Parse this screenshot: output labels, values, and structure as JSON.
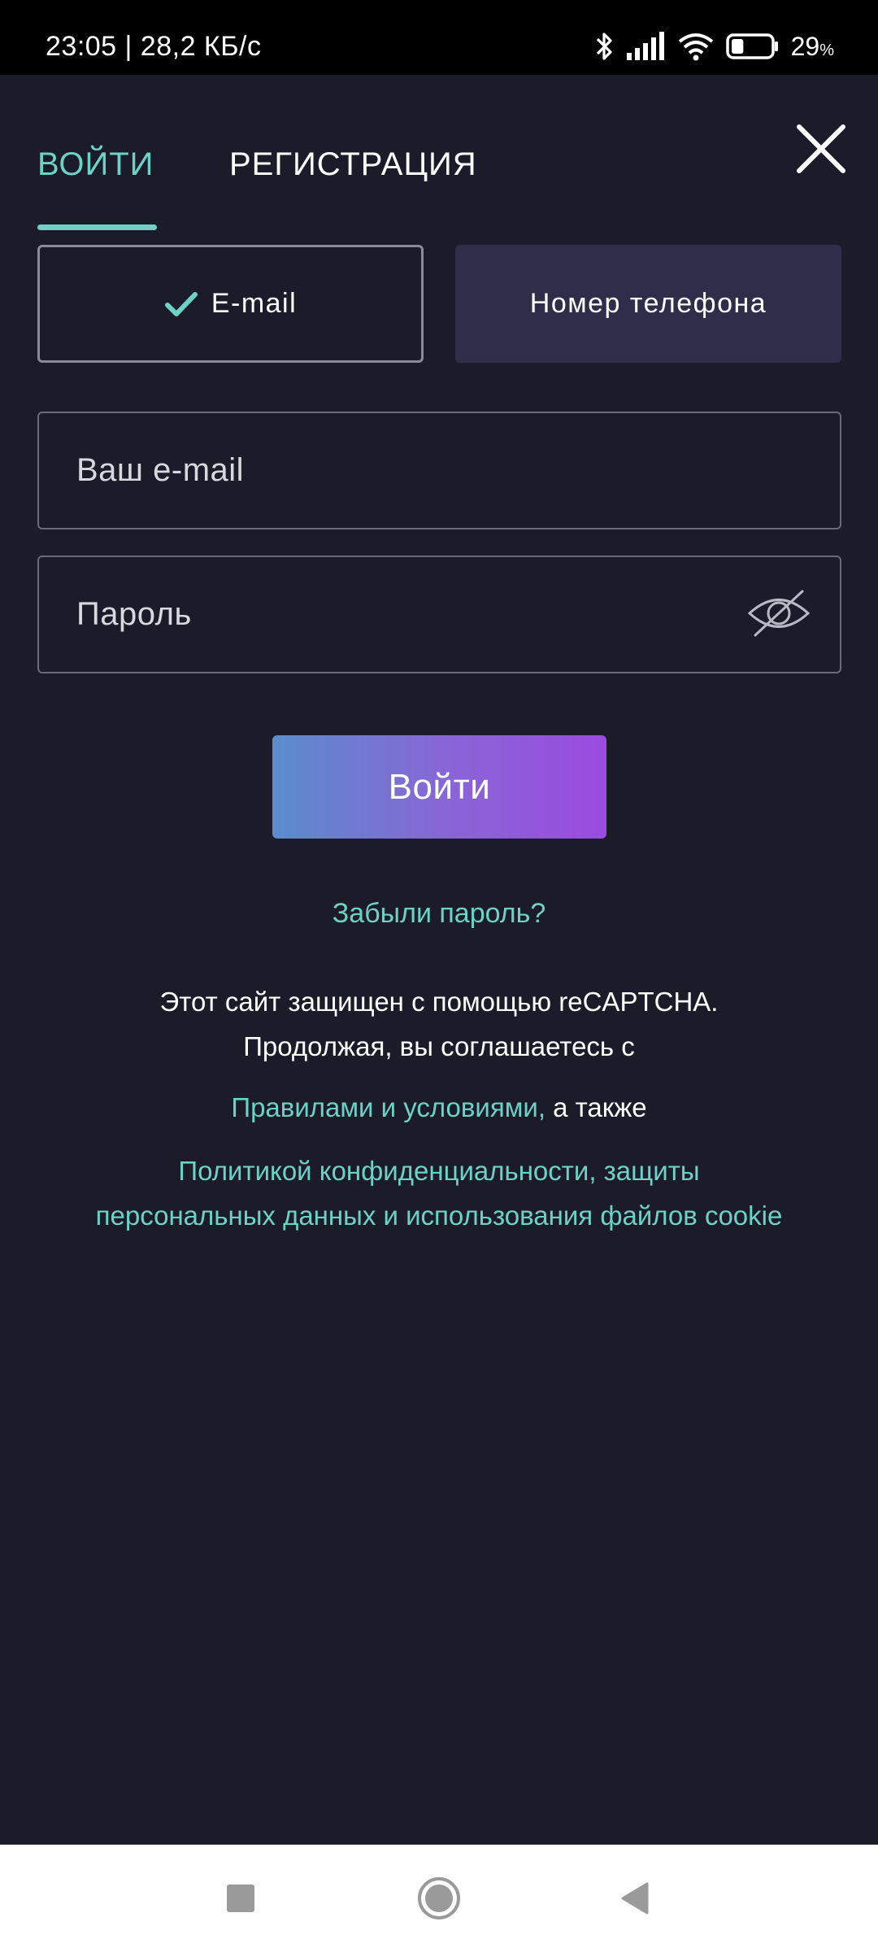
{
  "status_bar": {
    "time_speed": "23:05 | 28,2 КБ/с",
    "battery_percent": "29",
    "battery_unit": "%",
    "battery_level": 0.29,
    "icons": [
      "bluetooth-icon",
      "signal-icon",
      "wifi-icon",
      "battery-icon"
    ]
  },
  "tabs": [
    {
      "label": "ВОЙТИ",
      "active": true
    },
    {
      "label": "РЕГИСТРАЦИЯ",
      "active": false
    }
  ],
  "methods": {
    "email_label": "E-mail",
    "phone_label": "Номер телефона",
    "selected": "email"
  },
  "form": {
    "email_placeholder": "Ваш e-mail",
    "email_value": "",
    "password_placeholder": "Пароль",
    "password_value": "",
    "submit_label": "Войти"
  },
  "forgot_password": "Забыли пароль?",
  "legal": {
    "line1": "Этот сайт защищен с помощью reCAPTCHA.",
    "line2": "Продолжая, вы соглашаетесь с",
    "terms_link": "Правилами и условиями,",
    "and_text": " а также",
    "privacy_line1": "Политикой конфиденциальности, защиты",
    "privacy_line2": "персональных данных и использования файлов cookie"
  },
  "colors": {
    "background": "#1c1b29",
    "accent": "#6cd2c6",
    "phone_toggle_bg": "#302d4b",
    "button_gradient_start": "#5b8ccd",
    "button_gradient_end": "#9b4be0"
  }
}
